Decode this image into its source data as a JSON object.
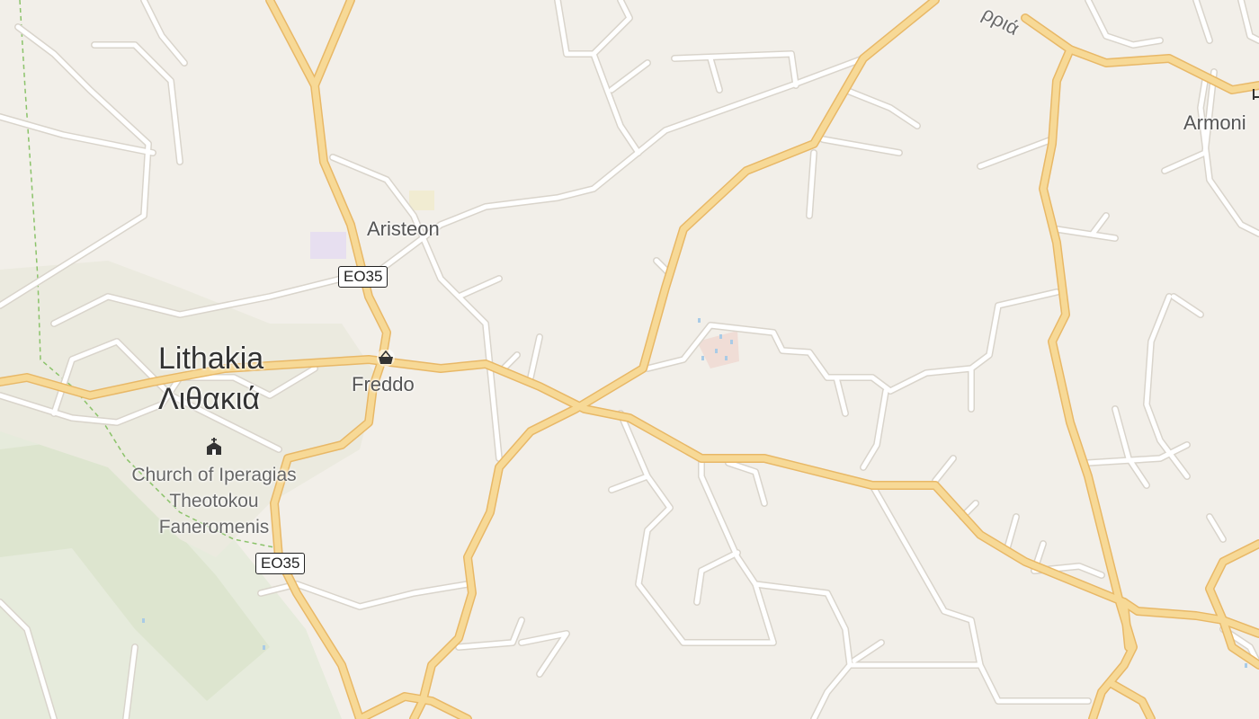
{
  "map": {
    "places": {
      "lithakia_latin": "Lithakia",
      "lithakia_greek": "Λιθακιά",
      "aristeon": "Aristeon",
      "freddo": "Freddo",
      "armonia_partial": "Armoni",
      "road_label_partial": "ρριά"
    },
    "church": {
      "line1": "Church of Iperagias",
      "line2": "Theotokou",
      "line3": "Faneromenis"
    },
    "road_shields": [
      "EO35",
      "EO35"
    ],
    "icons": {
      "shop": "basket-icon",
      "church": "church-icon"
    },
    "colors": {
      "background": "#f2efe9",
      "main_road": "#f7d996",
      "main_road_casing": "#e8b867",
      "minor_road": "#ffffff",
      "minor_road_casing": "#d9d4cb",
      "text": "#555555"
    }
  }
}
